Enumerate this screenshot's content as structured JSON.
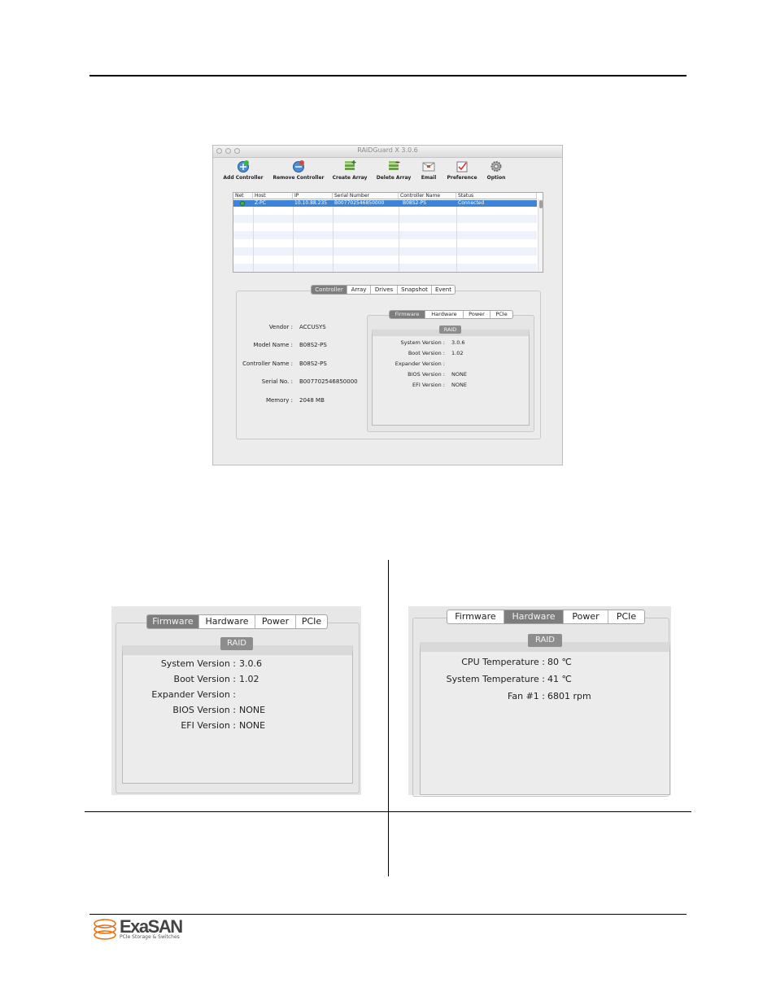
{
  "window": {
    "title": "RAIDGuard X 3.0.6",
    "toolbar": [
      {
        "label": "Add Controller",
        "icon": "add-controller-icon"
      },
      {
        "label": "Remove Controller",
        "icon": "remove-controller-icon"
      },
      {
        "label": "Create Array",
        "icon": "create-array-icon"
      },
      {
        "label": "Delete Array",
        "icon": "delete-array-icon"
      },
      {
        "label": "Email",
        "icon": "email-icon"
      },
      {
        "label": "Preference",
        "icon": "preference-icon"
      },
      {
        "label": "Option",
        "icon": "option-gear-icon"
      }
    ],
    "table": {
      "headers": [
        "Net",
        "Host",
        "IP",
        "Serial Number",
        "Controller Name",
        "Status"
      ],
      "row": {
        "host": "Z-PC",
        "ip": "10.10.88.235",
        "serial": "B007702546850000",
        "controller": "B08S2-PS",
        "status": "Connected"
      },
      "net_status_color": "#3cb93c"
    },
    "main_tabs": [
      "Controller",
      "Array",
      "Drives",
      "Snapshot",
      "Event"
    ],
    "main_tab_selected": "Controller",
    "controller_info": [
      {
        "label": "Vendor :",
        "value": "ACCUSYS"
      },
      {
        "label": "Model Name :",
        "value": "B08S2-PS"
      },
      {
        "label": "Controller Name :",
        "value": "B08S2-PS"
      },
      {
        "label": "Serial No. :",
        "value": "B007702546850000"
      },
      {
        "label": "Memory :",
        "value": "2048 MB"
      }
    ],
    "sub_tabs": [
      "Firmware",
      "Hardware",
      "Power",
      "PCIe"
    ],
    "sub_tab_selected": "Firmware",
    "raid_badge": "RAID",
    "firmware_info": [
      {
        "label": "System Version :",
        "value": "3.0.6"
      },
      {
        "label": "Boot Version :",
        "value": "1.02"
      },
      {
        "label": "Expander Version :",
        "value": ""
      },
      {
        "label": "BIOS Version :",
        "value": "NONE"
      },
      {
        "label": "EFI Version :",
        "value": "NONE"
      }
    ]
  },
  "firmware_panel": {
    "tabs": [
      "Firmware",
      "Hardware",
      "Power",
      "PCIe"
    ],
    "selected": "Firmware",
    "badge": "RAID",
    "rows": [
      {
        "label": "System Version :",
        "value": "3.0.6"
      },
      {
        "label": "Boot Version :",
        "value": "1.02"
      },
      {
        "label": "Expander Version :",
        "value": ""
      },
      {
        "label": "BIOS Version :",
        "value": "NONE"
      },
      {
        "label": "EFI Version :",
        "value": "NONE"
      }
    ]
  },
  "hardware_panel": {
    "tabs": [
      "Firmware",
      "Hardware",
      "Power",
      "PCIe"
    ],
    "selected": "Hardware",
    "badge": "RAID",
    "rows": [
      {
        "label": "CPU Temperature :",
        "value": "80 ℃"
      },
      {
        "label": "System Temperature :",
        "value": "41 ℃"
      },
      {
        "label": "Fan #1 :",
        "value": "6801 rpm"
      }
    ]
  },
  "footer": {
    "logo_text": "ExaSAN",
    "tagline": "PCIe Storage & Switches",
    "logo_color": "#e8741c"
  }
}
